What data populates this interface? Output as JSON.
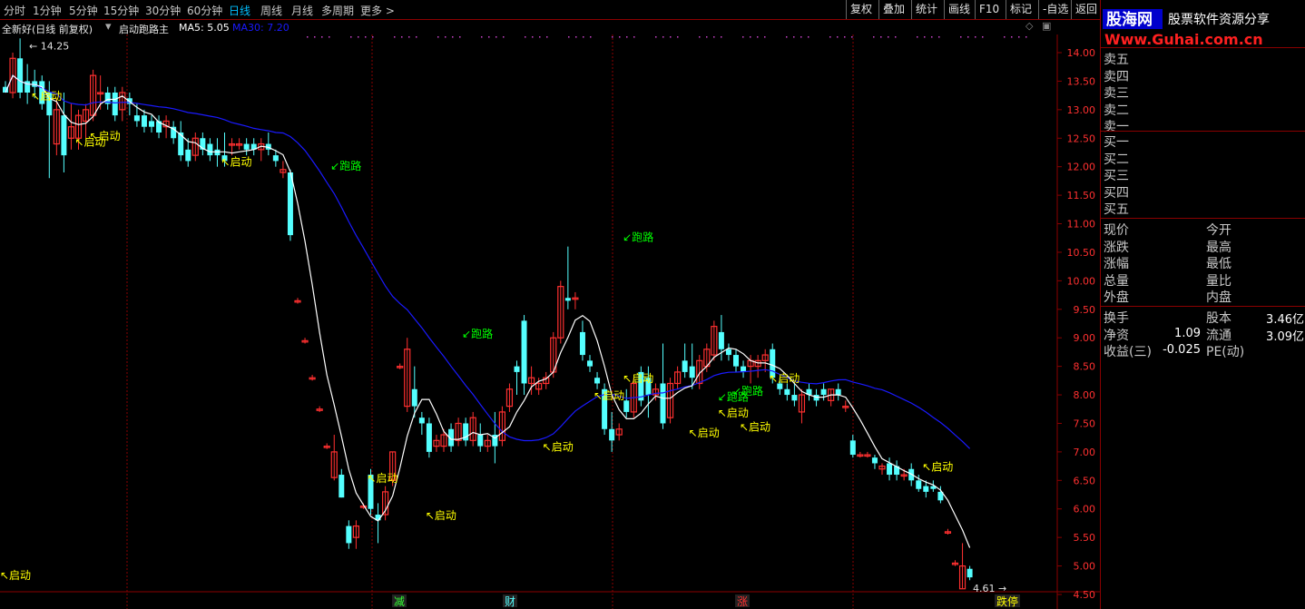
{
  "toolbar": {
    "periods": [
      "分时",
      "1分钟",
      "5分钟",
      "15分钟",
      "30分钟",
      "60分钟",
      "日线",
      "周线",
      "月线",
      "多周期",
      "更多 >"
    ],
    "active_period": "日线",
    "right_buttons": [
      "复权",
      "叠加",
      "统计",
      "画线",
      "F10",
      "标记",
      "-自选",
      "返回"
    ]
  },
  "info": {
    "stock_name": "全新好(日线 前复权)",
    "indicator_name": "启动跑路主",
    "ma5": "MA5: 5.05",
    "ma30": "MA30: 7.20"
  },
  "colors": {
    "up": "#ff3030",
    "down": "#54ffff",
    "ma5": "#ffffff",
    "ma30": "#1a1aff",
    "grid": "#8b0000",
    "axis_text": "#ff3030",
    "buy_signal": "#ffff00",
    "sell_signal": "#00ff00"
  },
  "chart_data": {
    "type": "candlestick",
    "y_ticks": [
      "14.00",
      "13.50",
      "13.00",
      "12.50",
      "12.00",
      "11.50",
      "11.00",
      "10.50",
      "10.00",
      "9.50",
      "9.00",
      "8.50",
      "8.00",
      "7.50",
      "7.00",
      "6.50",
      "6.00",
      "5.50",
      "5.00",
      "4.50"
    ],
    "ylim": [
      4.4,
      14.7
    ],
    "max_label": "14.25",
    "min_label": "4.61",
    "bottom_tags": [
      "减",
      "财",
      "涨",
      "跌停"
    ],
    "candles": [
      [
        13.4,
        13.5,
        13.3,
        13.3
      ],
      [
        13.3,
        14.0,
        13.2,
        13.9
      ],
      [
        13.9,
        14.25,
        13.2,
        13.3
      ],
      [
        13.5,
        13.8,
        13.1,
        13.3
      ],
      [
        13.5,
        13.7,
        13.2,
        13.4
      ],
      [
        13.5,
        13.6,
        13.0,
        13.1
      ],
      [
        13.3,
        13.5,
        11.8,
        12.9
      ],
      [
        12.4,
        13.2,
        12.2,
        13.0
      ],
      [
        12.9,
        13.3,
        11.9,
        12.2
      ],
      [
        12.5,
        13.1,
        12.3,
        12.7
      ],
      [
        12.5,
        13.0,
        12.3,
        12.9
      ],
      [
        12.8,
        13.1,
        12.5,
        13.0
      ],
      [
        12.9,
        13.7,
        12.8,
        13.6
      ],
      [
        13.3,
        13.6,
        13.0,
        13.3
      ],
      [
        13.3,
        13.4,
        13.0,
        13.1
      ],
      [
        13.3,
        13.4,
        12.8,
        12.9
      ],
      [
        13.0,
        13.4,
        12.8,
        13.3
      ],
      [
        13.2,
        13.3,
        12.9,
        13.1
      ],
      [
        12.9,
        13.1,
        12.7,
        12.8
      ],
      [
        12.9,
        13.0,
        12.6,
        12.7
      ],
      [
        12.8,
        12.9,
        12.6,
        12.7
      ],
      [
        12.8,
        12.9,
        12.5,
        12.6
      ],
      [
        12.7,
        12.9,
        12.5,
        12.8
      ],
      [
        12.7,
        12.8,
        12.4,
        12.5
      ],
      [
        12.6,
        12.8,
        12.1,
        12.2
      ],
      [
        12.3,
        12.5,
        12.0,
        12.1
      ],
      [
        12.2,
        12.6,
        12.1,
        12.5
      ],
      [
        12.5,
        12.6,
        12.2,
        12.3
      ],
      [
        12.4,
        12.5,
        12.1,
        12.2
      ],
      [
        12.3,
        12.5,
        12.0,
        12.2
      ],
      [
        12.2,
        12.6,
        12.0,
        12.1
      ],
      [
        12.4,
        12.5,
        12.2,
        12.4
      ],
      [
        12.4,
        12.5,
        12.3,
        12.4
      ],
      [
        12.4,
        12.5,
        12.2,
        12.3
      ],
      [
        12.4,
        12.5,
        12.2,
        12.3
      ],
      [
        12.3,
        12.5,
        12.1,
        12.4
      ],
      [
        12.4,
        12.6,
        12.2,
        12.3
      ],
      [
        12.2,
        12.3,
        12.0,
        12.1
      ],
      [
        11.9,
        12.1,
        11.8,
        11.95
      ],
      [
        11.9,
        11.95,
        10.7,
        10.8
      ],
      [
        9.65,
        9.7,
        9.6,
        9.65
      ],
      [
        8.95,
        9.0,
        8.9,
        8.95
      ],
      [
        8.3,
        8.35,
        8.25,
        8.3
      ],
      [
        7.75,
        7.8,
        7.7,
        7.75
      ],
      [
        7.1,
        7.15,
        7.05,
        7.1
      ],
      [
        6.55,
        7.3,
        6.5,
        7.0
      ],
      [
        6.6,
        6.7,
        6.2,
        6.2
      ],
      [
        5.7,
        5.8,
        5.3,
        5.4
      ],
      [
        5.5,
        5.8,
        5.3,
        5.7
      ],
      [
        6.05,
        6.1,
        6.0,
        6.05
      ],
      [
        6.6,
        6.7,
        5.9,
        6.0
      ],
      [
        5.9,
        6.1,
        5.4,
        5.8
      ],
      [
        5.9,
        6.4,
        5.8,
        6.3
      ],
      [
        6.5,
        7.0,
        6.4,
        7.0
      ],
      [
        8.5,
        8.55,
        8.45,
        8.5
      ],
      [
        7.8,
        9.0,
        7.7,
        8.8
      ],
      [
        8.1,
        8.5,
        7.6,
        7.8
      ],
      [
        7.6,
        7.7,
        7.3,
        7.5
      ],
      [
        7.5,
        7.6,
        6.9,
        7.0
      ],
      [
        7.1,
        7.3,
        7.0,
        7.2
      ],
      [
        7.1,
        7.4,
        7.0,
        7.3
      ],
      [
        7.4,
        7.5,
        7.0,
        7.1
      ],
      [
        7.2,
        7.6,
        7.1,
        7.5
      ],
      [
        7.5,
        7.6,
        7.1,
        7.2
      ],
      [
        7.2,
        7.7,
        7.1,
        7.6
      ],
      [
        7.3,
        7.5,
        7.0,
        7.1
      ],
      [
        7.1,
        7.3,
        7.0,
        7.2
      ],
      [
        7.3,
        7.7,
        6.8,
        7.1
      ],
      [
        7.2,
        7.8,
        7.1,
        7.7
      ],
      [
        7.8,
        8.2,
        7.7,
        8.1
      ],
      [
        8.5,
        8.6,
        8.0,
        8.4
      ],
      [
        9.3,
        9.4,
        8.0,
        8.2
      ],
      [
        8.2,
        8.5,
        8.0,
        8.3
      ],
      [
        8.1,
        8.3,
        8.0,
        8.2
      ],
      [
        8.2,
        8.4,
        8.1,
        8.3
      ],
      [
        8.4,
        9.1,
        8.3,
        9.0
      ],
      [
        9.0,
        10.0,
        8.9,
        9.9
      ],
      [
        9.7,
        10.6,
        9.5,
        9.65
      ],
      [
        9.7,
        9.8,
        9.5,
        9.7
      ],
      [
        9.1,
        9.3,
        8.6,
        8.7
      ],
      [
        8.6,
        8.7,
        8.4,
        8.5
      ],
      [
        8.3,
        8.4,
        8.1,
        8.2
      ],
      [
        8.1,
        8.2,
        7.3,
        7.4
      ],
      [
        7.4,
        7.7,
        7.0,
        7.2
      ],
      [
        7.3,
        7.5,
        7.2,
        7.4
      ],
      [
        7.9,
        8.1,
        7.6,
        7.7
      ],
      [
        7.7,
        8.3,
        7.6,
        8.2
      ],
      [
        8.4,
        8.5,
        7.8,
        7.9
      ],
      [
        8.3,
        8.5,
        7.6,
        8.0
      ],
      [
        8.0,
        8.2,
        7.9,
        8.1
      ],
      [
        8.2,
        8.9,
        7.4,
        7.5
      ],
      [
        7.6,
        8.3,
        7.5,
        8.2
      ],
      [
        8.2,
        8.5,
        8.1,
        8.4
      ],
      [
        8.6,
        8.9,
        8.3,
        8.4
      ],
      [
        8.5,
        8.9,
        8.1,
        8.3
      ],
      [
        8.2,
        8.7,
        8.1,
        8.6
      ],
      [
        8.5,
        8.9,
        8.4,
        8.8
      ],
      [
        8.7,
        9.3,
        8.6,
        9.2
      ],
      [
        9.1,
        9.4,
        8.6,
        8.8
      ],
      [
        8.8,
        8.9,
        8.6,
        8.7
      ],
      [
        8.7,
        8.8,
        8.4,
        8.5
      ],
      [
        8.5,
        8.6,
        8.3,
        8.4
      ],
      [
        8.5,
        8.7,
        8.2,
        8.6
      ],
      [
        8.5,
        8.7,
        8.3,
        8.6
      ],
      [
        8.6,
        8.8,
        8.4,
        8.7
      ],
      [
        8.8,
        8.9,
        8.2,
        8.3
      ],
      [
        8.2,
        8.3,
        8.0,
        8.1
      ],
      [
        8.1,
        8.2,
        7.9,
        8.0
      ],
      [
        8.0,
        8.2,
        7.8,
        7.9
      ],
      [
        7.7,
        8.1,
        7.5,
        8.0
      ],
      [
        8.1,
        8.2,
        7.9,
        8.0
      ],
      [
        8.0,
        8.1,
        7.8,
        7.9
      ],
      [
        8.1,
        8.2,
        7.9,
        8.0
      ],
      [
        7.9,
        8.1,
        7.8,
        8.1
      ],
      [
        8.1,
        8.2,
        7.9,
        8.0
      ],
      [
        7.8,
        7.9,
        7.7,
        7.8
      ],
      [
        7.2,
        7.3,
        6.9,
        6.95
      ],
      [
        6.95,
        7.0,
        6.9,
        6.95
      ],
      [
        6.95,
        7.0,
        6.9,
        6.95
      ],
      [
        6.9,
        6.95,
        6.7,
        6.8
      ],
      [
        6.7,
        6.8,
        6.6,
        6.75
      ],
      [
        6.8,
        6.9,
        6.5,
        6.6
      ],
      [
        6.75,
        6.85,
        6.5,
        6.6
      ],
      [
        6.6,
        6.7,
        6.5,
        6.6
      ],
      [
        6.7,
        6.8,
        6.4,
        6.5
      ],
      [
        6.5,
        6.6,
        6.3,
        6.35
      ],
      [
        6.4,
        6.5,
        6.2,
        6.3
      ],
      [
        6.4,
        6.5,
        6.3,
        6.35
      ],
      [
        6.3,
        6.4,
        6.1,
        6.15
      ],
      [
        5.6,
        5.65,
        5.55,
        5.6
      ],
      [
        5.05,
        5.1,
        5.0,
        5.05
      ],
      [
        4.6,
        5.4,
        4.61,
        5.0
      ],
      [
        4.95,
        5.0,
        4.75,
        4.8
      ]
    ],
    "ma5_start_index": 0,
    "ma30_start_index": 0,
    "buy_labels": [
      {
        "i": 3,
        "text": "启动",
        "y": 13.25
      },
      {
        "i": 9,
        "text": "启动",
        "y": 12.45
      },
      {
        "i": 11,
        "text": "启动",
        "y": 12.55
      },
      {
        "i": 29,
        "text": "启动",
        "y": 12.1
      },
      {
        "i": 49,
        "text": "启动",
        "y": 6.55
      },
      {
        "i": 57,
        "text": "启动",
        "y": 5.9
      },
      {
        "i": 73,
        "text": "启动",
        "y": 7.1
      },
      {
        "i": 80,
        "text": "启动",
        "y": 8.0
      },
      {
        "i": 84,
        "text": "启动",
        "y": 8.3
      },
      {
        "i": 93,
        "text": "启动",
        "y": 7.35
      },
      {
        "i": 97,
        "text": "启动",
        "y": 7.7
      },
      {
        "i": 100,
        "text": "启动",
        "y": 7.45
      },
      {
        "i": 104,
        "text": "启动",
        "y": 8.3
      },
      {
        "i": 125,
        "text": "启动",
        "y": 6.75
      },
      {
        "i": 136,
        "text": "启动",
        "y": 4.85
      }
    ],
    "sell_labels": [
      {
        "i": 44,
        "text": "跑路",
        "y": 11.95
      },
      {
        "i": 62,
        "text": "跑路",
        "y": 9.0
      },
      {
        "i": 84,
        "text": "跑路",
        "y": 10.7
      },
      {
        "i": 97,
        "text": "跑路",
        "y": 7.9
      },
      {
        "i": 99,
        "text": "跑路",
        "y": 8.0
      }
    ]
  },
  "right_panel": {
    "logo_text": "股海网",
    "logo_sub": "股票软件资源分享",
    "logo_url": "Www.Guhai.com.cn",
    "asks": [
      "卖五",
      "卖四",
      "卖三",
      "卖二",
      "卖一"
    ],
    "bids": [
      "买一",
      "买二",
      "买三",
      "买四",
      "买五"
    ],
    "quote_left": [
      "现价",
      "涨跌",
      "涨幅",
      "总量",
      "外盘"
    ],
    "quote_right": [
      "今开",
      "最高",
      "最低",
      "量比",
      "内盘"
    ],
    "stats": [
      {
        "label": "换手",
        "value": "",
        "label2": "股本",
        "value2": "3.46亿"
      },
      {
        "label": "净资",
        "value": "1.09",
        "label2": "流通",
        "value2": "3.09亿"
      },
      {
        "label": "收益(三)",
        "value": "-0.025",
        "label2": "PE(动)",
        "value2": ""
      }
    ]
  }
}
